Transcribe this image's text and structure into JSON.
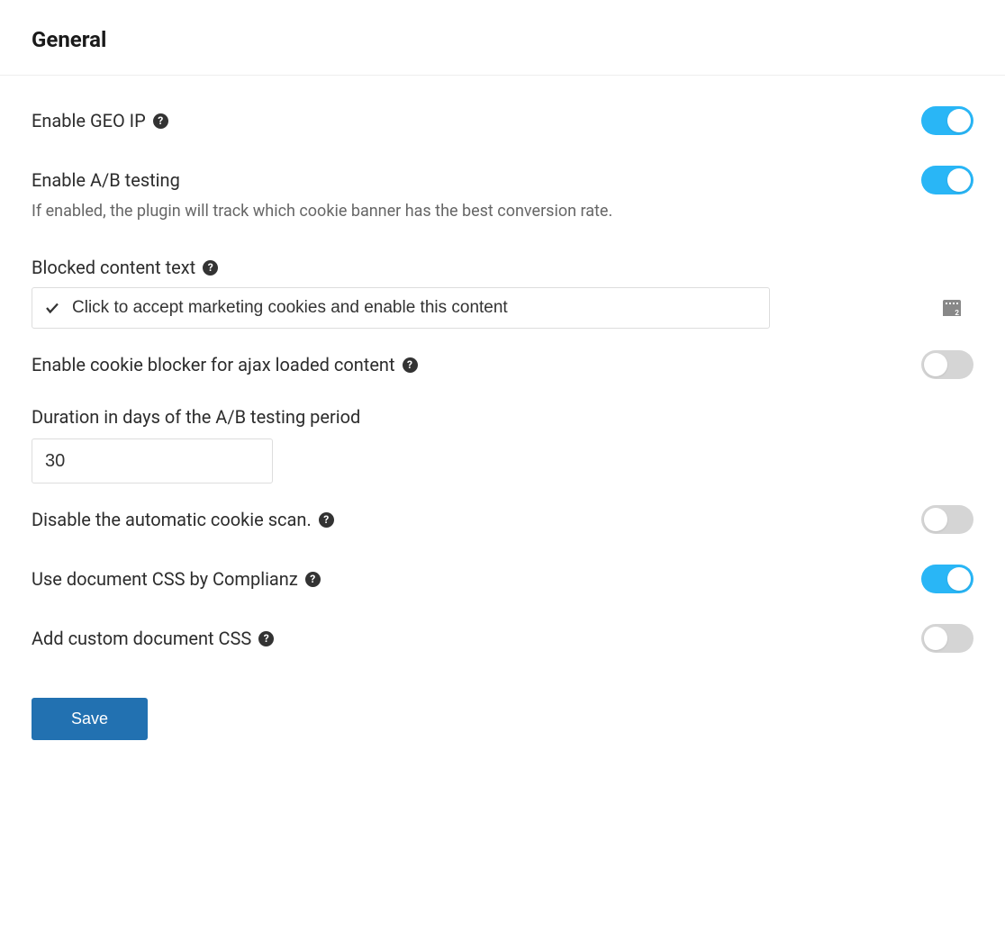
{
  "header": {
    "title": "General"
  },
  "settings": {
    "geo_ip": {
      "label": "Enable GEO IP",
      "has_help": true,
      "enabled": true
    },
    "ab_testing": {
      "label": "Enable A/B testing",
      "description": "If enabled, the plugin will track which cookie banner has the best conversion rate.",
      "has_help": false,
      "enabled": true
    },
    "blocked_content": {
      "label": "Blocked content text",
      "has_help": true,
      "value": "Click to accept marketing cookies and enable this content"
    },
    "ajax_blocker": {
      "label": "Enable cookie blocker for ajax loaded content",
      "has_help": true,
      "enabled": false
    },
    "ab_duration": {
      "label": "Duration in days of the A/B testing period",
      "has_help": false,
      "value": "30"
    },
    "disable_scan": {
      "label": "Disable the automatic cookie scan.",
      "has_help": true,
      "enabled": false
    },
    "doc_css": {
      "label": "Use document CSS by Complianz",
      "has_help": true,
      "enabled": true
    },
    "custom_css": {
      "label": "Add custom document CSS",
      "has_help": true,
      "enabled": false
    }
  },
  "actions": {
    "save_label": "Save"
  },
  "colors": {
    "toggle_on": "#29b6f6",
    "toggle_off": "#d5d5d5",
    "primary_button": "#2271b1"
  }
}
